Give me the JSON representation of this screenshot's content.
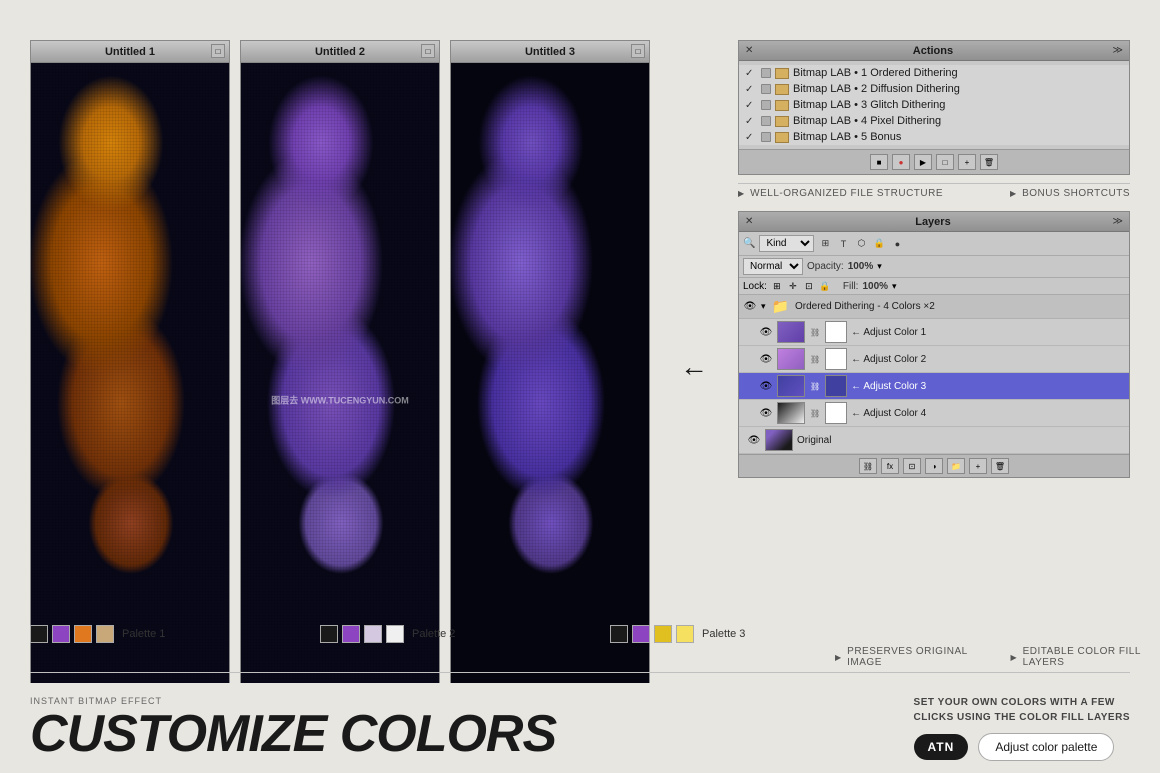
{
  "windows": [
    {
      "id": "canvas-1",
      "title": "Untitled 1",
      "palette": {
        "colors": [
          "#1a1a1a",
          "#8c44c0",
          "#e07820",
          "#c8a878"
        ],
        "label": "Palette 1"
      }
    },
    {
      "id": "canvas-2",
      "title": "Untitled 2",
      "palette": {
        "colors": [
          "#1a1a1a",
          "#8c44c0",
          "#d4c8e0",
          "#f0f0f0"
        ],
        "label": "Palette 2"
      }
    },
    {
      "id": "canvas-3",
      "title": "Untitled 3",
      "palette": {
        "colors": [
          "#1a1a1a",
          "#8c44c0",
          "#e0c020",
          "#f5e060"
        ],
        "label": "Palette 3"
      }
    }
  ],
  "actions_panel": {
    "title": "Actions",
    "items": [
      "Bitmap LAB • 1 Ordered Dithering",
      "Bitmap LAB • 2 Diffusion Dithering",
      "Bitmap LAB • 3 Glitch Dithering",
      "Bitmap LAB • 4 Pixel Dithering",
      "Bitmap LAB • 5 Bonus"
    ],
    "toolbar_buttons": [
      "●",
      "▶",
      "□",
      "□",
      "🗑"
    ]
  },
  "info_strip_top": {
    "left": "WELL-ORGANIZED FILE STRUCTURE",
    "right": "BONUS SHORTCUTS"
  },
  "layers_panel": {
    "title": "Layers",
    "search_placeholder": "Kind",
    "blend_mode": "Normal",
    "opacity": "100%",
    "fill": "100%",
    "group_name": "Ordered Dithering - 4 Colors ×2",
    "layers": [
      {
        "name": "← Adjust Color 1",
        "color": "#8060c0",
        "mask": "white"
      },
      {
        "name": "← Adjust Color 2",
        "color": "#c080e0",
        "mask": "white"
      },
      {
        "name": "← Adjust Color 3",
        "color": "#4040a0",
        "mask": "white",
        "selected": true
      },
      {
        "name": "← Adjust Color 4",
        "color": "#1a1a1a",
        "mask": "white"
      }
    ],
    "original_layer": "Original"
  },
  "info_strip_bottom": {
    "left": "PRESERVES ORIGINAL IMAGE",
    "right": "EDITABLE COLOR FILL LAYERS"
  },
  "cta": {
    "instant_label": "INSTANT BITMAP EFFECT",
    "title": "CUSTOMIZE COLORS",
    "description": "SET YOUR OWN COLORS WITH A FEW\nCLICKS USING THE COLOR FILL LAYERS",
    "badge": "ATN",
    "button": "Adjust color palette"
  },
  "watermark": "图层去 WWW.TUCENGYUN.COM"
}
